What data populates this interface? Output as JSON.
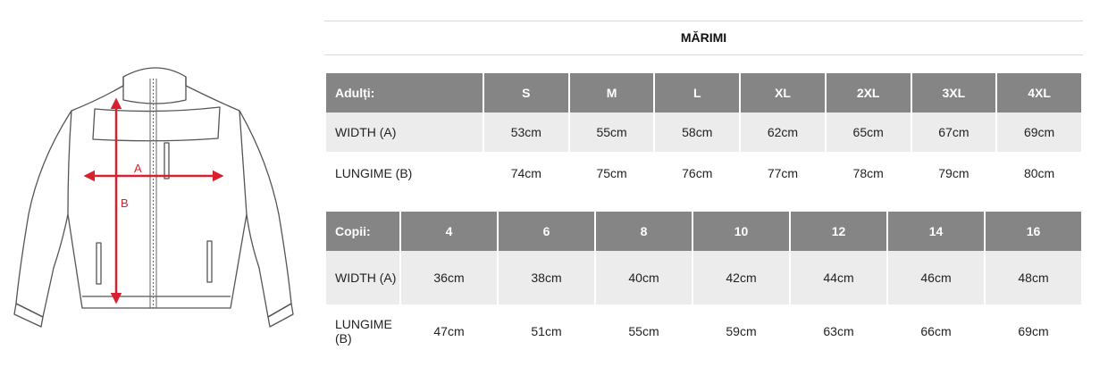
{
  "title": "MĂRIMI",
  "diagram": {
    "label_a": "A",
    "label_b": "B",
    "arrow_color": "#d9202e"
  },
  "adult_table": {
    "header": "Adulți:",
    "sizes": [
      "S",
      "M",
      "L",
      "XL",
      "2XL",
      "3XL",
      "4XL"
    ],
    "rows": [
      {
        "label": "WIDTH (A)",
        "values": [
          "53cm",
          "55cm",
          "58cm",
          "62cm",
          "65cm",
          "67cm",
          "69cm"
        ]
      },
      {
        "label": "LUNGIME (B)",
        "values": [
          "74cm",
          "75cm",
          "76cm",
          "77cm",
          "78cm",
          "79cm",
          "80cm"
        ]
      }
    ]
  },
  "kids_table": {
    "header": "Copii:",
    "sizes": [
      "4",
      "6",
      "8",
      "10",
      "12",
      "14",
      "16"
    ],
    "rows": [
      {
        "label": "WIDTH (A)",
        "values": [
          "36cm",
          "38cm",
          "40cm",
          "42cm",
          "44cm",
          "46cm",
          "48cm"
        ]
      },
      {
        "label": "LUNGIME (B)",
        "values": [
          "47cm",
          "51cm",
          "55cm",
          "59cm",
          "63cm",
          "66cm",
          "69cm"
        ]
      }
    ]
  },
  "colors": {
    "header_bg": "#858585",
    "shaded_row": "#ececec",
    "accent": "#d9202e"
  }
}
